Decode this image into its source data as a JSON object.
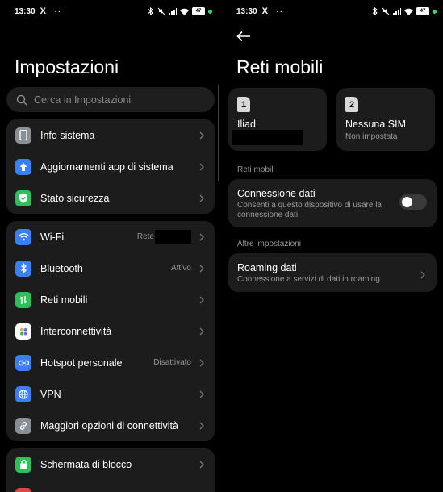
{
  "status_bar": {
    "time": "13:30",
    "x_icon": "X",
    "dots": "···",
    "battery": "47"
  },
  "left": {
    "title": "Impostazioni",
    "search_placeholder": "Cerca in Impostazioni",
    "groups": [
      [
        {
          "label": "Info sistema",
          "icon": "phone-icon",
          "color": "#8a8f96"
        },
        {
          "label": "Aggiornamenti app di sistema",
          "icon": "arrow-up-icon",
          "color": "#3b7ff5"
        },
        {
          "label": "Stato sicurezza",
          "icon": "shield-icon",
          "color": "#2fbf5a"
        }
      ],
      [
        {
          "label": "Wi-Fi",
          "value": "Rete",
          "icon": "wifi-icon",
          "color": "#3b7ff5"
        },
        {
          "label": "Bluetooth",
          "value": "Attivo",
          "icon": "bluetooth-icon",
          "color": "#3b7ff5"
        },
        {
          "label": "Reti mobili",
          "icon": "mobile-data-icon",
          "color": "#2fbf5a"
        },
        {
          "label": "Interconnettività",
          "icon": "interconnect-icon",
          "color": "#ffffff"
        },
        {
          "label": "Hotspot personale",
          "value": "Disattivato",
          "icon": "hotspot-icon",
          "color": "#3b7ff5"
        },
        {
          "label": "VPN",
          "icon": "vpn-icon",
          "color": "#3b7ff5"
        },
        {
          "label": "Maggiori opzioni di connettività",
          "icon": "link-icon",
          "color": "#8a8f96"
        }
      ],
      [
        {
          "label": "Schermata di blocco",
          "icon": "lock-icon",
          "color": "#2fbf5a"
        }
      ]
    ]
  },
  "right": {
    "title": "Reti mobili",
    "sims": [
      {
        "number": "1",
        "name": "Iliad",
        "sub": ""
      },
      {
        "number": "2",
        "name": "Nessuna SIM",
        "sub": "Non impostata"
      }
    ],
    "section1": "Reti mobili",
    "data_conn": {
      "title": "Connessione dati",
      "desc": "Consenti a questo dispositivo di usare la connessione dati",
      "enabled": false
    },
    "section2": "Altre impostazioni",
    "roaming": {
      "title": "Roaming dati",
      "desc": "Connessione a servizi di dati in roaming"
    }
  }
}
